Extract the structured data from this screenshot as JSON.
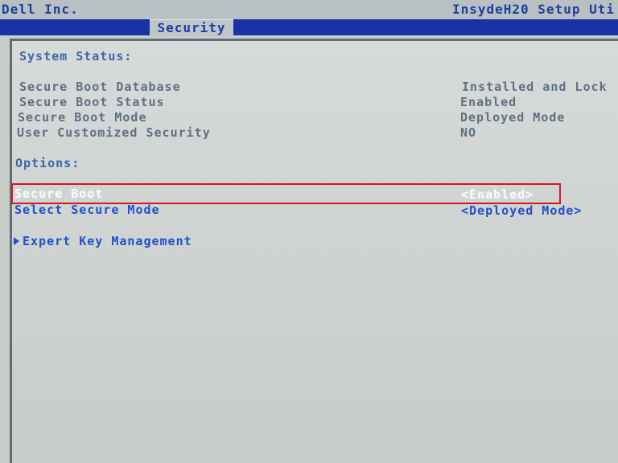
{
  "header": {
    "vendor": "Dell Inc.",
    "app_title": "InsydeH20 Setup Uti",
    "tabs": [
      {
        "label": "Security",
        "active": true
      }
    ]
  },
  "status": {
    "heading": "System Status:",
    "items": [
      {
        "label": "Secure Boot Database",
        "value": "Installed and Lock"
      },
      {
        "label": "Secure Boot Status",
        "value": "Enabled"
      },
      {
        "label": "Secure Boot Mode",
        "value": "Deployed Mode"
      },
      {
        "label": "User Customized Security",
        "value": "NO"
      }
    ]
  },
  "options": {
    "heading": "Options:",
    "items": [
      {
        "label": "Secure Boot",
        "value": "<Enabled>",
        "selected": true
      },
      {
        "label": "Select Secure Mode",
        "value": "<Deployed Mode>",
        "selected": false
      }
    ],
    "submenu": {
      "label": "Expert Key Management",
      "icon": "chevron-right-icon"
    }
  },
  "colors": {
    "title_text": "#1c3f9f",
    "tabbar": "#1733a7",
    "option_text": "#1f4fd0",
    "status_text": "#5d7182",
    "highlight": "#d11a22",
    "background": "#c9cdca"
  }
}
